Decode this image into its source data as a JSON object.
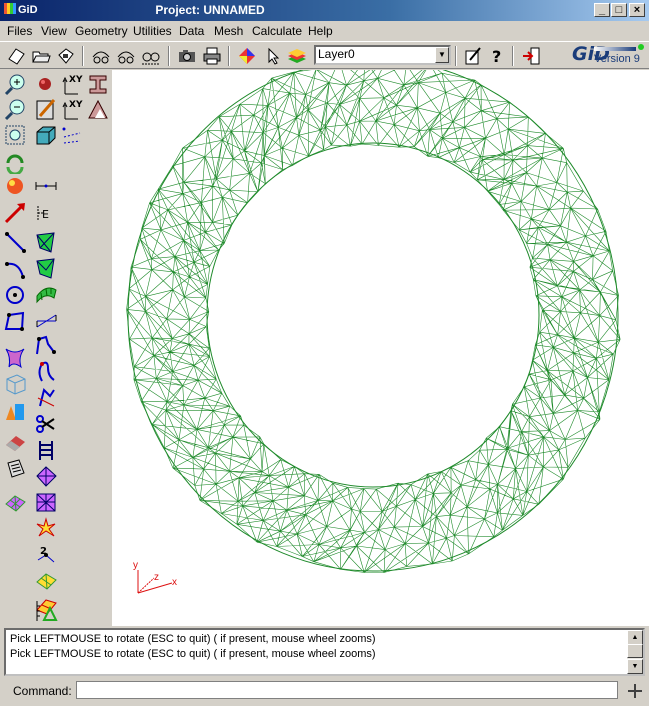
{
  "window": {
    "logo_text": "GiD",
    "title": "Project: UNNAMED",
    "min_glyph": "_",
    "max_glyph": "□",
    "close_glyph": "×"
  },
  "menu": [
    "Files",
    "View",
    "Geometry",
    "Utilities",
    "Data",
    "Mesh",
    "Calculate",
    "Help"
  ],
  "toolbar": {
    "layer_value": "Layer0",
    "icons": [
      "new-file-icon",
      "open-folder-icon",
      "save-icon",
      "rotate-view-icon",
      "rotate-view-alt-icon",
      "zoom-binoculars-icon",
      "camera-icon",
      "printer-icon",
      "render-mode-icon",
      "pointer-icon",
      "layers-icon",
      "edit-properties-icon",
      "help-icon",
      "exit-icon"
    ]
  },
  "brand": {
    "logo": "GiD",
    "version": "Version 9"
  },
  "palette": {
    "icons": [
      "zoom-in-icon",
      "zoom-out-icon",
      "zoom-frame-icon",
      "redraw-icon",
      "render-icon",
      "point-arrow-icon",
      "line-icon",
      "arc-icon",
      "circle-icon",
      "polyline-icon",
      "surface-icon",
      "volume-cube-icon",
      "solid-shapes-icon",
      "eraser-icon",
      "list-icon",
      "mesh-icon",
      "sphere-icon",
      "edit-icon",
      "cube-icon",
      "dotted-arrows-icon",
      "distance-icon",
      "dimension-icon",
      "nurbs-surface-icon",
      "coons-surface-icon",
      "surface-mesh-icon",
      "surface-wave-icon",
      "lines-join-icon",
      "knot-icon",
      "knot-alt-icon",
      "scissors-icon",
      "ladder-icon",
      "mesh-warp-icon",
      "mesh-star-icon",
      "star-burst-icon",
      "node-number-icon",
      "mesh-quad-icon",
      "mesh-flat-icon",
      "ruler-triangle-icon"
    ],
    "xy_label": "XY"
  },
  "axes": {
    "y": "y",
    "z": "z",
    "x": "x"
  },
  "colors": {
    "mesh": "#1e8a2a",
    "axes": "#dd1111"
  },
  "messages": [
    "Pick LEFTMOUSE to rotate (ESC to quit) ( if present, mouse wheel zooms)",
    "Pick LEFTMOUSE to rotate (ESC to quit) ( if present, mouse wheel zooms)"
  ],
  "command": {
    "label": "Command:",
    "value": ""
  }
}
